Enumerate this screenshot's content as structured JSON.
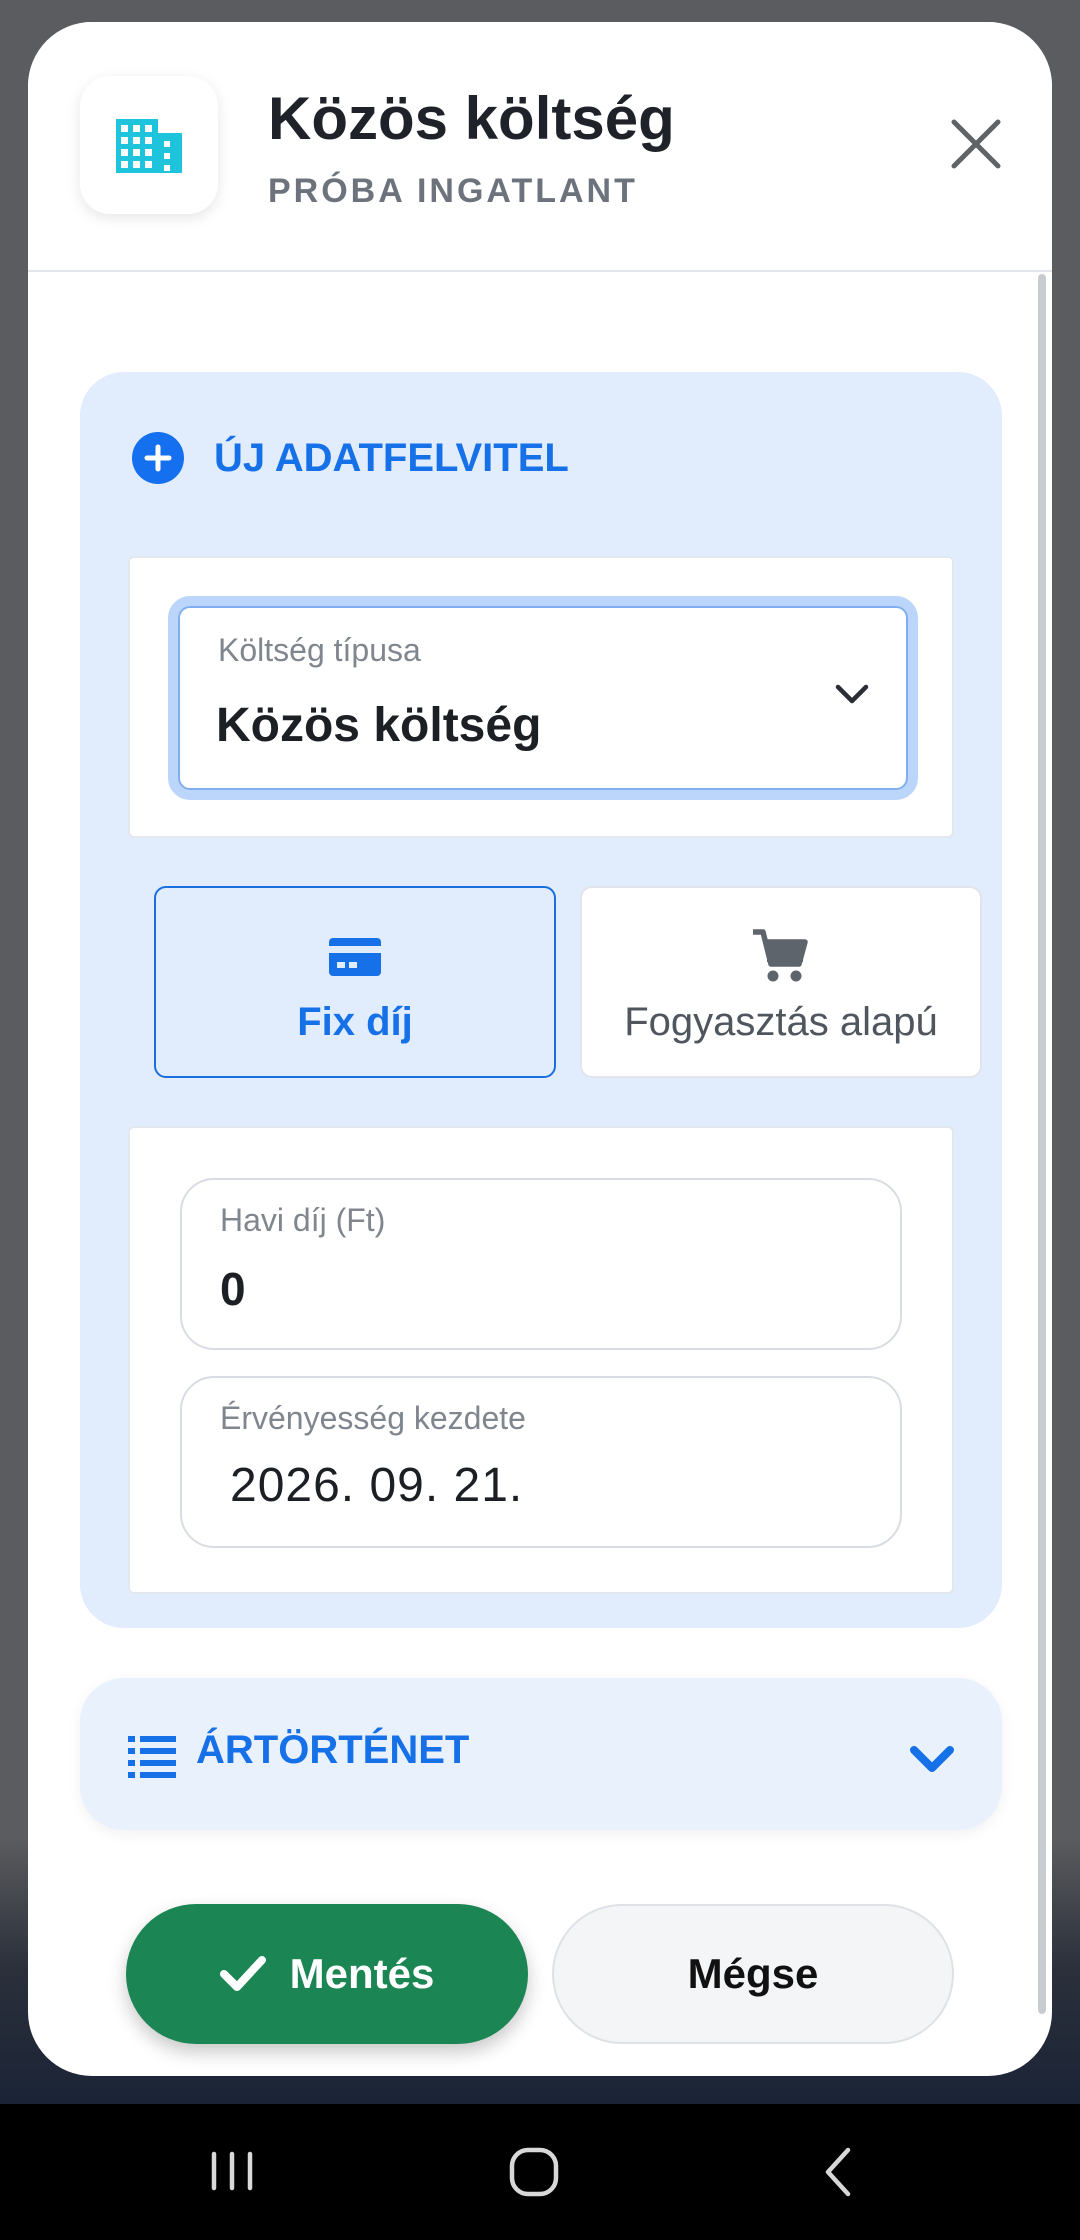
{
  "header": {
    "title": "Közös költség",
    "subtitle": "PRÓBA INGATLANT"
  },
  "new_entry": {
    "title": "ÚJ ADATFELVITEL",
    "cost_type": {
      "label": "Költség típusa",
      "value": "Közös költség"
    },
    "pricing_options": [
      {
        "label": "Fix díj",
        "selected": true,
        "icon": "credit-card-icon"
      },
      {
        "label": "Fogyasztás alapú",
        "selected": false,
        "icon": "cart-icon"
      }
    ],
    "monthly_fee": {
      "label": "Havi díj (Ft)",
      "value": "0"
    },
    "valid_from": {
      "label": "Érvényesség kezdete",
      "value": "2026. 09. 21."
    }
  },
  "history": {
    "title": "ÁRTÖRTÉNET"
  },
  "actions": {
    "save": "Mentés",
    "cancel": "Mégse"
  },
  "colors": {
    "accent": "#1670e8",
    "panel_bg": "#e1ecfd",
    "save_green": "#1b8553",
    "building_icon": "#1ec3dc"
  }
}
